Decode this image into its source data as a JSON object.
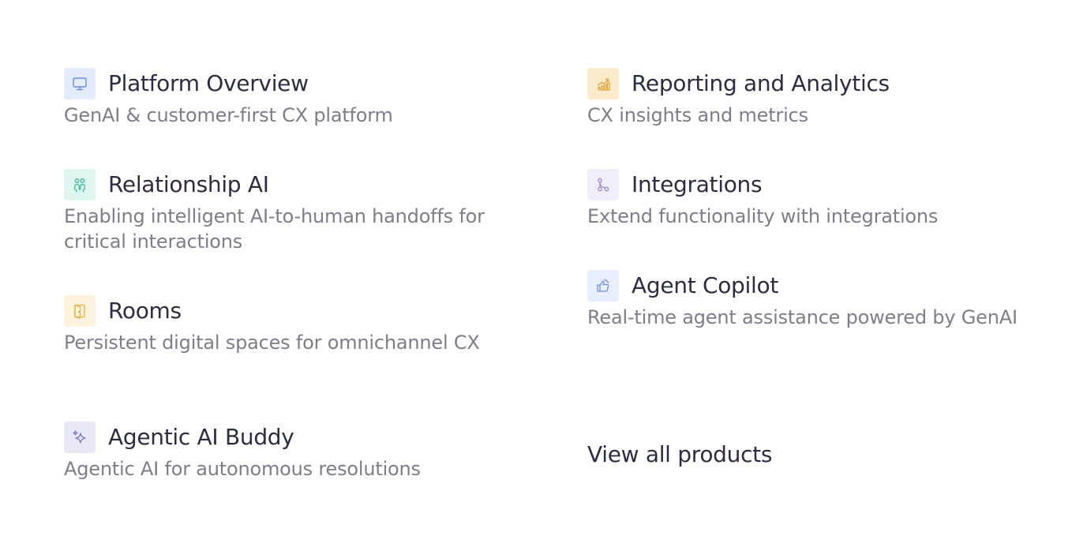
{
  "menu": {
    "left": [
      {
        "title": "Platform Overview",
        "description": "GenAI & customer-first CX platform",
        "icon": "monitor-icon",
        "icon_bg": "#e4ebfd",
        "icon_color": "#6b8fe8"
      },
      {
        "title": "Relationship AI",
        "description": "Enabling intelligent AI-to-human handoffs for critical interactions",
        "icon": "people-icon",
        "icon_bg": "#dff5f0",
        "icon_color": "#3fb8a0"
      },
      {
        "title": "Rooms",
        "description": "Persistent digital spaces for omnichannel CX",
        "icon": "door-icon",
        "icon_bg": "#fdf3dc",
        "icon_color": "#e0b44d"
      },
      {
        "title": "Agentic AI Buddy",
        "description": "Agentic AI for autonomous resolutions",
        "icon": "sparkle-icon",
        "icon_bg": "#e9e8f6",
        "icon_color": "#7a74c9"
      }
    ],
    "right": [
      {
        "title": "Reporting and Analytics",
        "description": "CX insights and metrics",
        "icon": "chart-icon",
        "icon_bg": "#fbeacc",
        "icon_color": "#e0a23a"
      },
      {
        "title": "Integrations",
        "description": "Extend functionality with integrations",
        "icon": "integration-icon",
        "icon_bg": "#f1eefa",
        "icon_color": "#9b86d6"
      },
      {
        "title": "Agent Copilot",
        "description": "Real-time agent assistance powered by GenAI",
        "icon": "thumbs-up-icon",
        "icon_bg": "#e8eefb",
        "icon_color": "#6f92e0"
      }
    ],
    "view_all_label": "View all products"
  }
}
